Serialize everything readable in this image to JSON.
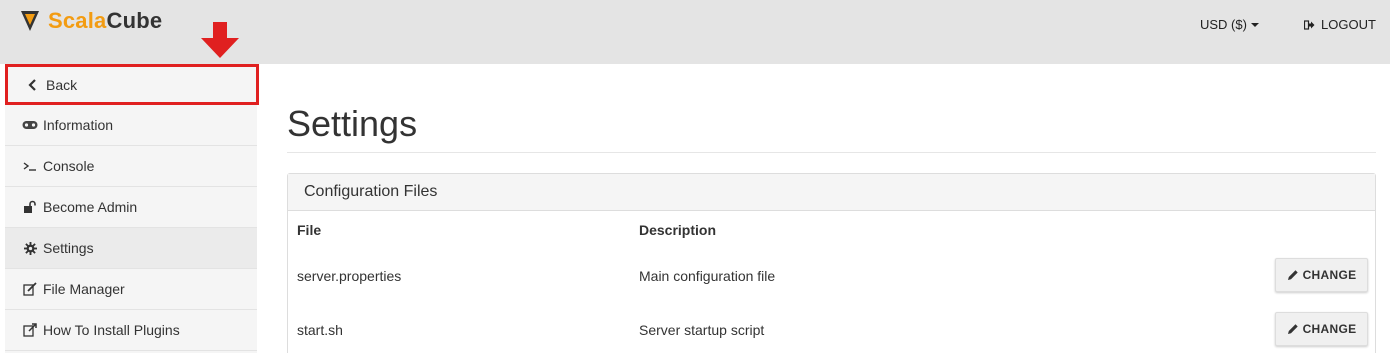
{
  "app": {
    "logo_part1": "Scala",
    "logo_part2": "Cube",
    "logo_icon": "triangle-down-logo-icon"
  },
  "header": {
    "currency": "USD ($)",
    "logout": "LOGOUT"
  },
  "sidebar": {
    "back": "Back",
    "items": [
      {
        "label": "Information",
        "icon": "gamepad-icon"
      },
      {
        "label": "Console",
        "icon": "terminal-icon"
      },
      {
        "label": "Become Admin",
        "icon": "unlock-icon"
      },
      {
        "label": "Settings",
        "icon": "gear-icon",
        "active": true
      },
      {
        "label": "File Manager",
        "icon": "edit-icon"
      },
      {
        "label": "How To Install Plugins",
        "icon": "external-link-icon"
      }
    ]
  },
  "main": {
    "title": "Settings",
    "panel": {
      "title": "Configuration Files",
      "columns": [
        "File",
        "Description"
      ],
      "rows": [
        {
          "file": "server.properties",
          "description": "Main configuration file",
          "action": "CHANGE"
        },
        {
          "file": "start.sh",
          "description": "Server startup script",
          "action": "CHANGE"
        }
      ]
    }
  },
  "colors": {
    "accent": "#f39c12",
    "highlight": "#e02020",
    "topbar": "#e4e4e4"
  }
}
